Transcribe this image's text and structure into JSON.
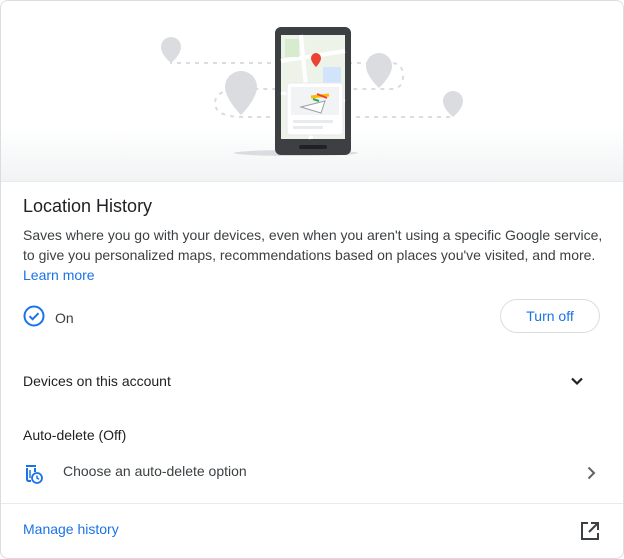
{
  "section": {
    "title": "Location History",
    "description": "Saves where you go with your devices, even when you aren't using a specific Google service, to give you personalized maps, recommendations based on places you've visited, and more.",
    "learn_more_label": "Learn more"
  },
  "status": {
    "icon": "check-circle-icon",
    "label": "On",
    "turn_off_label": "Turn off",
    "accent_color": "#1a73e8"
  },
  "devices": {
    "label": "Devices on this account",
    "icon": "chevron-down-icon"
  },
  "auto_delete": {
    "title": "Auto-delete (Off)",
    "option_label": "Choose an auto-delete option",
    "option_icon": "auto-delete-icon",
    "chevron_icon": "chevron-right-icon"
  },
  "footer": {
    "manage_label": "Manage history",
    "external_icon": "open-in-new-icon"
  }
}
